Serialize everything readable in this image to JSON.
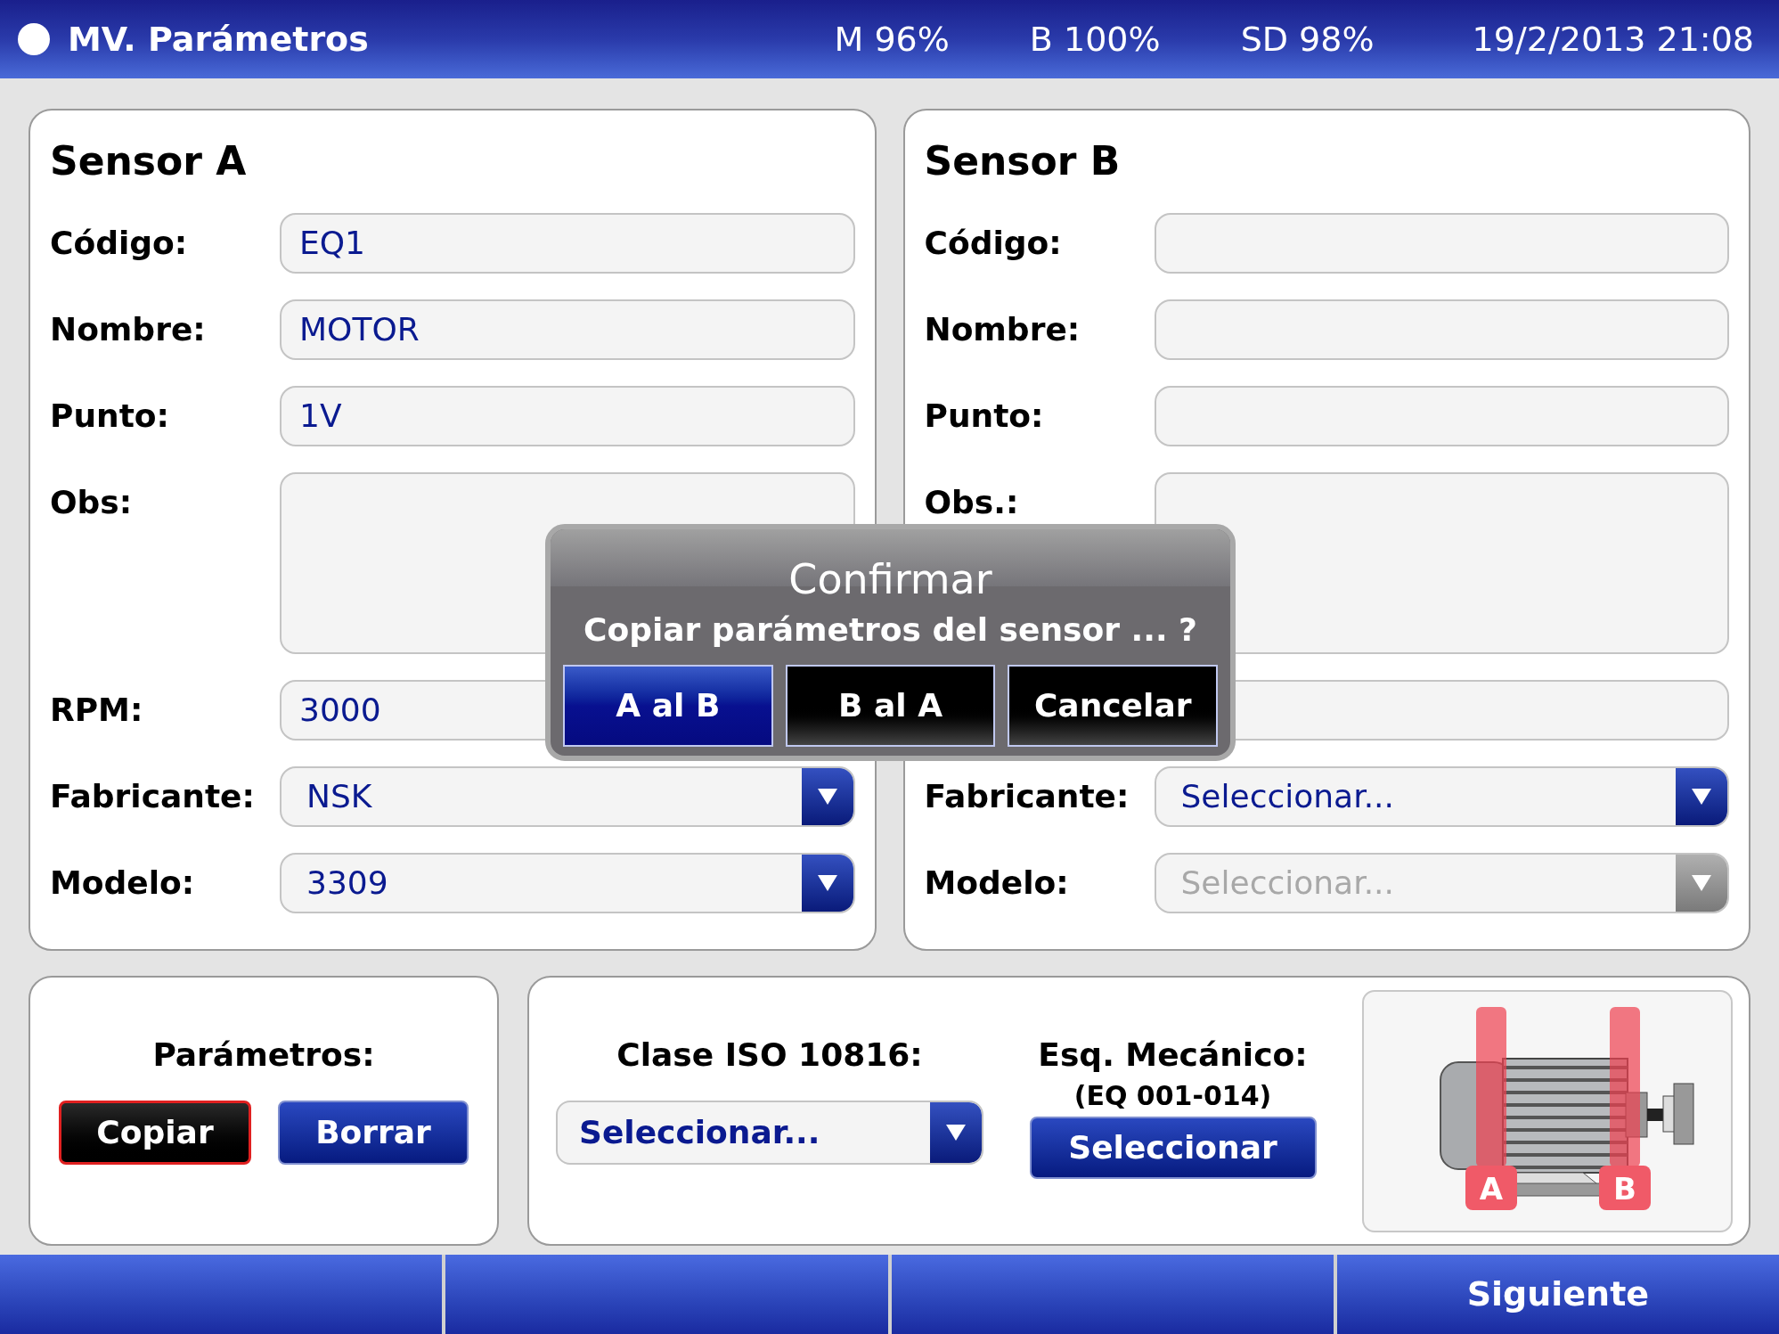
{
  "header": {
    "title": "MV. Parámetros",
    "stats": [
      "M 96%",
      "B 100%",
      "SD 98%"
    ],
    "datetime": "19/2/2013 21:08"
  },
  "sensors": [
    {
      "title": "Sensor A",
      "fields": [
        {
          "kind": "text",
          "label": "Código:",
          "value": "EQ1"
        },
        {
          "kind": "text",
          "label": "Nombre:",
          "value": "MOTOR"
        },
        {
          "kind": "text",
          "label": "Punto:",
          "value": "1V"
        },
        {
          "kind": "textarea",
          "label": "Obs:"
        },
        {
          "kind": "text",
          "label": "RPM:",
          "value": "3000"
        },
        {
          "kind": "select",
          "label": "Fabricante:",
          "value": "NSK",
          "disabled": false
        },
        {
          "kind": "select",
          "label": "Modelo:",
          "value": "3309",
          "disabled": false
        }
      ]
    },
    {
      "title": "Sensor B",
      "fields": [
        {
          "kind": "text",
          "label": "Código:"
        },
        {
          "kind": "text",
          "label": "Nombre:"
        },
        {
          "kind": "text",
          "label": "Punto:"
        },
        {
          "kind": "textarea",
          "label": "Obs.:"
        },
        {
          "kind": "text"
        },
        {
          "kind": "select",
          "label": "Fabricante:",
          "value": "Seleccionar...",
          "disabled": false
        },
        {
          "kind": "select",
          "label": "Modelo:",
          "value": "Seleccionar...",
          "disabled": true
        }
      ]
    }
  ],
  "parameters": {
    "label": "Parámetros:",
    "buttons": [
      {
        "label": "Copiar",
        "selected": true
      },
      {
        "label": "Borrar",
        "selected": false
      }
    ]
  },
  "iso_class": {
    "label": "Clase ISO 10816:",
    "value": "Seleccionar..."
  },
  "mechanical": {
    "label": "Esq. Mecánico:",
    "sublabel": "(EQ 001-014)",
    "button": "Seleccionar",
    "markers": [
      {
        "label": "A"
      },
      {
        "label": "B"
      }
    ]
  },
  "footer": {
    "buttons": [
      {
        "kind": "blank"
      },
      {
        "kind": "blank"
      },
      {
        "kind": "blank"
      },
      {
        "kind": "label",
        "label": "Siguiente"
      }
    ]
  },
  "dialog": {
    "title": "Confirmar",
    "message": "Copiar parámetros del sensor ... ?",
    "buttons": [
      {
        "label": "A al B",
        "selected": true
      },
      {
        "label": "B al A",
        "selected": false
      },
      {
        "label": "Cancelar",
        "selected": false
      }
    ]
  }
}
